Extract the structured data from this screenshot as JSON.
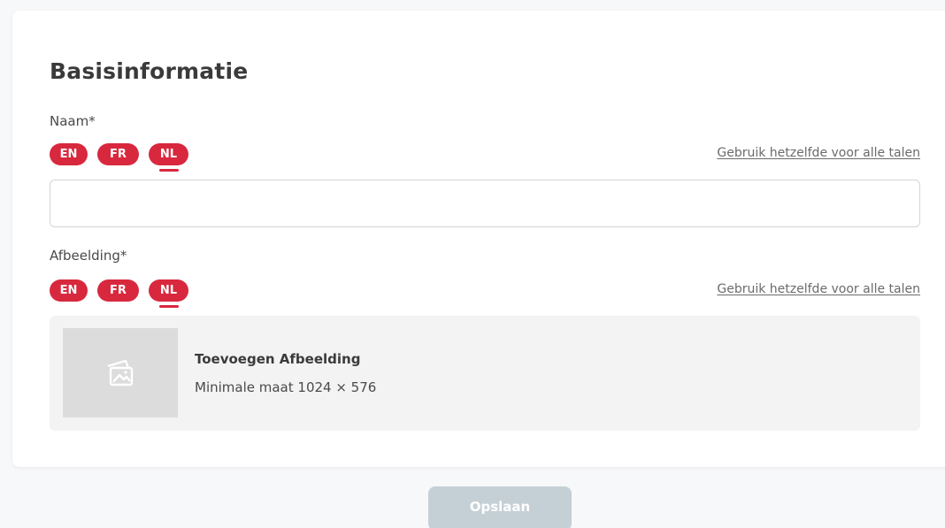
{
  "section": {
    "title": "Basisinformatie"
  },
  "name_field": {
    "label": "Naam*",
    "value": "",
    "placeholder": "",
    "languages": [
      "EN",
      "FR",
      "NL"
    ],
    "active_language": "NL",
    "same_for_all_link": "Gebruik hetzelfde voor alle talen"
  },
  "image_field": {
    "label": "Afbeelding*",
    "languages": [
      "EN",
      "FR",
      "NL"
    ],
    "active_language": "NL",
    "same_for_all_link": "Gebruik hetzelfde voor alle talen",
    "add_title": "Toevoegen Afbeelding",
    "min_size_text": "Minimale maat 1024 × 576",
    "thumb_icon": "image-placeholder-icon"
  },
  "actions": {
    "save_label": "Opslaan"
  },
  "colors": {
    "accent": "#d8283e",
    "save_button_disabled": "#c5d0d6",
    "image_box_bg": "#f3f3f3"
  }
}
